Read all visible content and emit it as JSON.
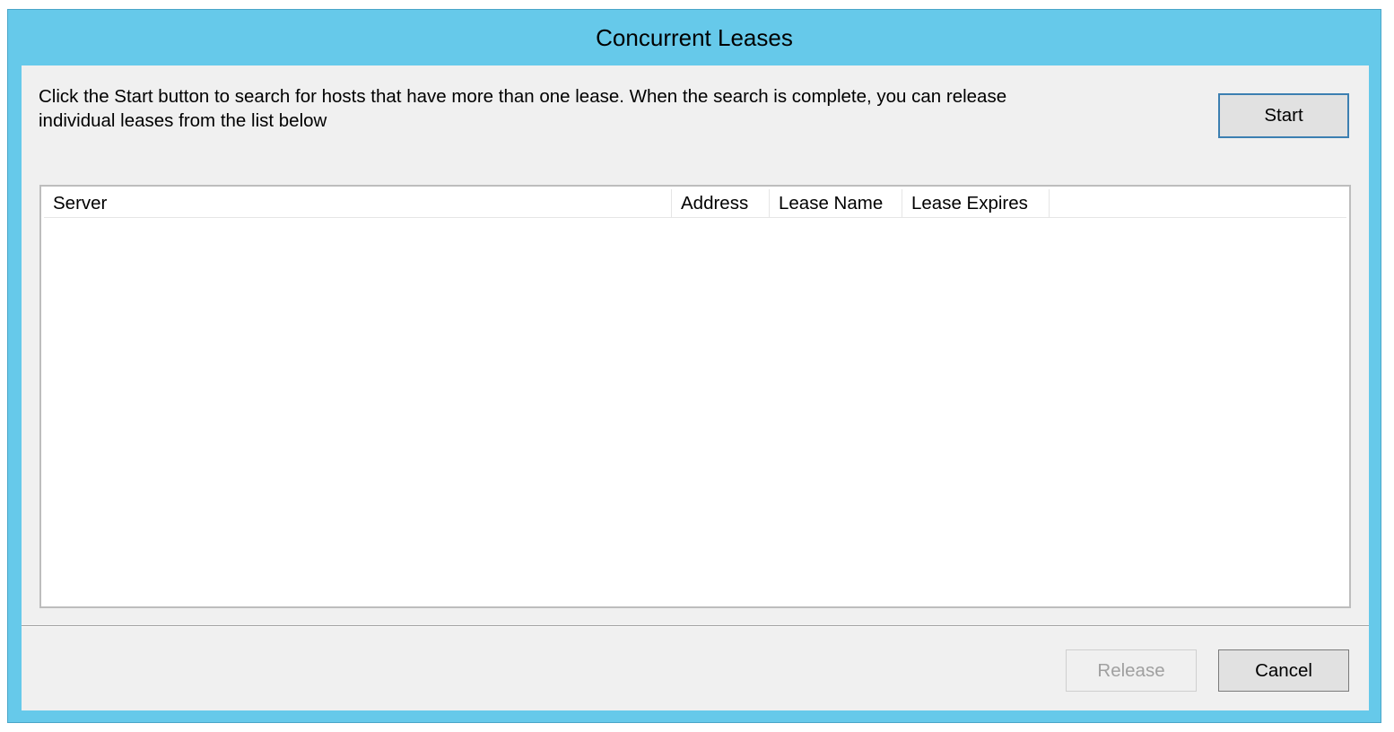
{
  "window": {
    "title": "Concurrent Leases"
  },
  "instructions": {
    "line1": "Click the Start button to search for hosts that have more than one lease.  When the search is complete, you can release",
    "line2": "individual leases from the list below"
  },
  "buttons": {
    "start": "Start",
    "release": "Release",
    "cancel": "Cancel"
  },
  "lease_list": {
    "columns": [
      "Server",
      "Address",
      "Lease Name",
      "Lease Expires"
    ],
    "rows": []
  },
  "colors": {
    "title_bar": "#66c9ea",
    "client_area": "#f0f0f0",
    "focus_border": "#3c7fb1"
  }
}
